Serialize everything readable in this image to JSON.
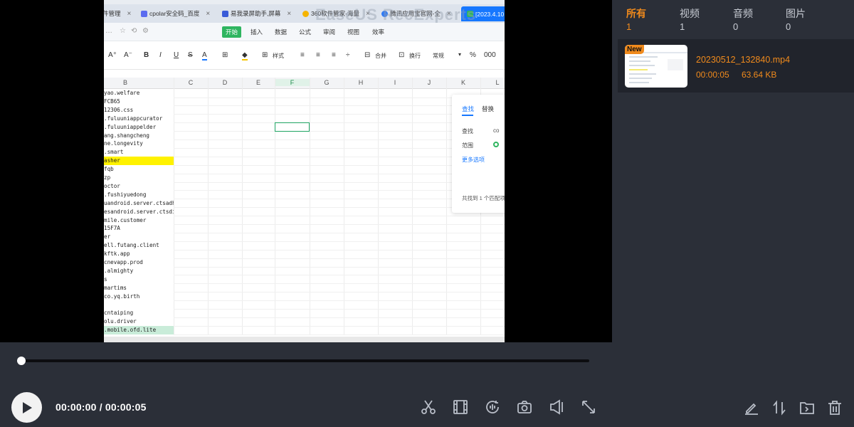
{
  "video": {
    "watermark": "EaseUS RecExperts",
    "browser_tabs": [
      {
        "label": "件管理",
        "active": false
      },
      {
        "label": "cpolar安全码_百度",
        "active": false
      },
      {
        "label": "易我录屏助手,屏幕",
        "active": false
      },
      {
        "label": "360软件管家-海量",
        "active": false
      },
      {
        "label": "腾讯应用宝官网-全",
        "active": false
      },
      {
        "label": "[2023.4.10",
        "active": true
      }
    ],
    "ribbon_menu": [
      "开始",
      "插入",
      "数据",
      "公式",
      "审阅",
      "视图",
      "效率"
    ],
    "toolbar": {
      "style": "样式",
      "merge": "合并",
      "wrap": "换行",
      "normal": "常规"
    },
    "columns": [
      "B",
      "C",
      "D",
      "E",
      "F",
      "G",
      "H",
      "I",
      "J",
      "K",
      "L"
    ],
    "rows": [
      {
        "text": "yao.welfare",
        "hl": ""
      },
      {
        "text": "FCB65",
        "hl": ""
      },
      {
        "text": "12306.css",
        "hl": ""
      },
      {
        "text": ".fuluuniappcurator",
        "hl": ""
      },
      {
        "text": ".fuluuniappelder",
        "hl": ""
      },
      {
        "text": "ang.shangcheng",
        "hl": ""
      },
      {
        "text": "ne.longevity",
        "hl": ""
      },
      {
        "text": ".smart",
        "hl": ""
      },
      {
        "text": "asher",
        "hl": "yellow"
      },
      {
        "text": "fqb",
        "hl": ""
      },
      {
        "text": "zp",
        "hl": ""
      },
      {
        "text": "octor",
        "hl": ""
      },
      {
        "text": ".fushiyuedong",
        "hl": ""
      },
      {
        "text": "uandroid.server.ctsadhere",
        "hl": ""
      },
      {
        "text": "esandroid.server.ctsdissol",
        "hl": ""
      },
      {
        "text": "mile.customer",
        "hl": ""
      },
      {
        "text": "15F7A",
        "hl": ""
      },
      {
        "text": "er",
        "hl": ""
      },
      {
        "text": "ell.futang.client",
        "hl": ""
      },
      {
        "text": "kftk.app",
        "hl": ""
      },
      {
        "text": "cnevapp.prod",
        "hl": ""
      },
      {
        "text": ".almighty",
        "hl": ""
      },
      {
        "text": "s",
        "hl": ""
      },
      {
        "text": "martims",
        "hl": ""
      },
      {
        "text": "co.yq.birth",
        "hl": ""
      },
      {
        "text": "",
        "hl": ""
      },
      {
        "text": "cntaiping",
        "hl": ""
      },
      {
        "text": "olu.driver",
        "hl": ""
      },
      {
        "text": ".mobile.ofd.lite",
        "hl": "green"
      }
    ],
    "find_panel": {
      "tab_find": "查找",
      "tab_replace": "替换",
      "find_label": "查找",
      "find_value": "co",
      "scope_label": "范围",
      "more_options": "更多选项",
      "result": "共找到 1 个匹配项"
    }
  },
  "player": {
    "time_display": "00:00:00 / 00:00:05",
    "progress": 0.0
  },
  "library": {
    "filters": [
      {
        "label": "所有",
        "count": "1",
        "active": true
      },
      {
        "label": "视频",
        "count": "1",
        "active": false
      },
      {
        "label": "音频",
        "count": "0",
        "active": false
      },
      {
        "label": "图片",
        "count": "0",
        "active": false
      }
    ],
    "items": [
      {
        "badge": "New",
        "name": "20230512_132840.mp4",
        "duration": "00:00:05",
        "size": "63.64 KB"
      }
    ]
  },
  "colors": {
    "accent": "#f08a1c",
    "panel_bg": "#2b2f38",
    "item_bg": "#21242c"
  }
}
